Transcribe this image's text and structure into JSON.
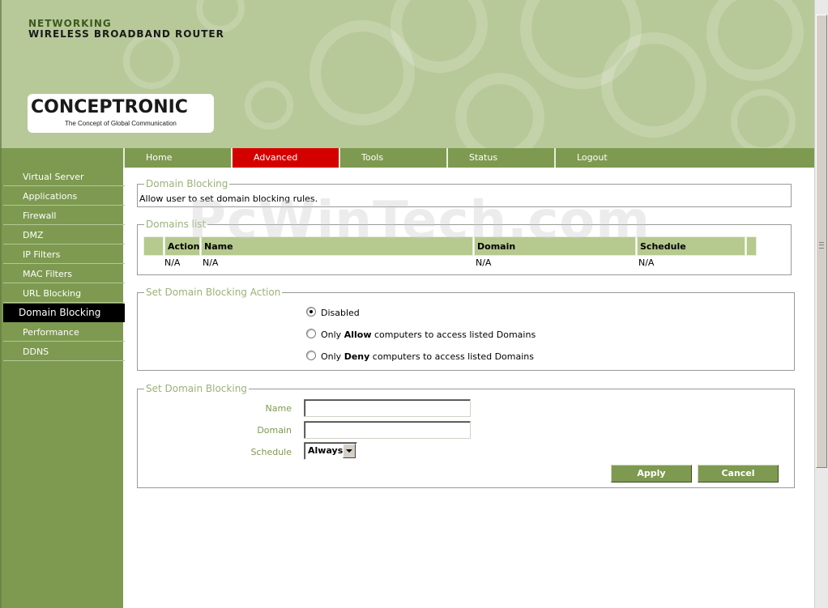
{
  "header": {
    "brand_line1": "NETWORKING",
    "brand_line2": "WIRELESS BROADBAND ROUTER",
    "logo_word": "CONCEPTRONIC",
    "logo_tagline": "The Concept of Global Communication"
  },
  "nav": {
    "tabs": [
      {
        "label": "Home"
      },
      {
        "label": "Advanced"
      },
      {
        "label": "Tools"
      },
      {
        "label": "Status"
      },
      {
        "label": "Logout"
      }
    ],
    "active_tab": "Advanced"
  },
  "sidebar": {
    "items": [
      {
        "label": "Virtual Server"
      },
      {
        "label": "Applications"
      },
      {
        "label": "Firewall"
      },
      {
        "label": "DMZ"
      },
      {
        "label": "IP Filters"
      },
      {
        "label": "MAC Filters"
      },
      {
        "label": "URL Blocking"
      },
      {
        "label": "Domain Blocking"
      },
      {
        "label": "Performance"
      },
      {
        "label": "DDNS"
      }
    ],
    "active_item": "Domain Blocking"
  },
  "domain_blocking": {
    "legend": "Domain Blocking",
    "description": "Allow user to set domain blocking rules."
  },
  "domains_list": {
    "legend": "Domains list",
    "columns": [
      "Action",
      "Name",
      "Domain",
      "Schedule"
    ],
    "rows": [
      {
        "action": "N/A",
        "name": "N/A",
        "domain": "N/A",
        "schedule": "N/A"
      }
    ]
  },
  "action_section": {
    "legend": "Set Domain Blocking Action",
    "options": [
      {
        "label": "Disabled",
        "checked": true
      },
      {
        "prefix": "Only ",
        "bold": "Allow",
        "suffix": " computers to access listed Domains",
        "checked": false
      },
      {
        "prefix": "Only ",
        "bold": "Deny",
        "suffix": " computers to access listed Domains",
        "checked": false
      }
    ]
  },
  "set_section": {
    "legend": "Set Domain Blocking",
    "name_label": "Name",
    "name_value": "",
    "domain_label": "Domain",
    "domain_value": "",
    "schedule_label": "Schedule",
    "schedule_value": "Always",
    "apply_label": "Apply",
    "cancel_label": "Cancel"
  },
  "watermark": "PcWinTech.com",
  "colors": {
    "header_bg": "#b7c998",
    "nav_green": "#7d9a50",
    "active_tab": "#d40000",
    "active_sidebar": "#000000",
    "legend_text": "#9ab27a",
    "table_header": "#b6c98e"
  }
}
